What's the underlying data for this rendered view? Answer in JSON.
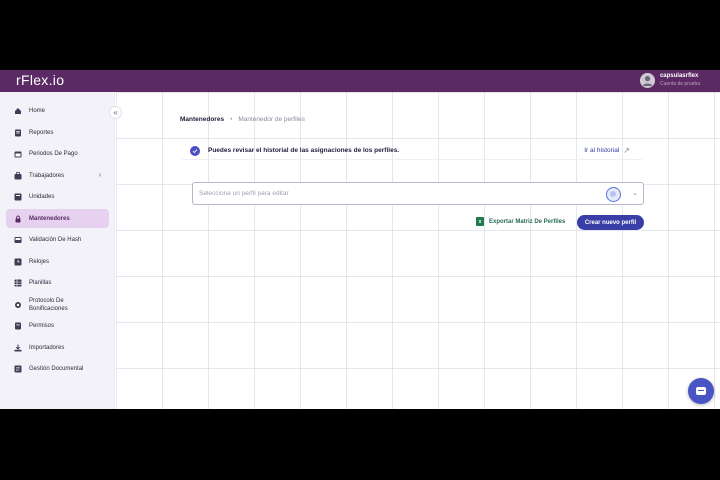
{
  "app": {
    "logo": "rFlex.io",
    "user_name": "capsulasrflex",
    "user_subtitle": "Cuenta de prueba"
  },
  "sidebar": {
    "items": [
      {
        "label": "Home",
        "icon": "home-icon",
        "active": false
      },
      {
        "label": "Reportes",
        "icon": "report-icon",
        "active": false
      },
      {
        "label": "Periodos De Pago",
        "icon": "calendar-icon",
        "active": false
      },
      {
        "label": "Trabajadores",
        "icon": "workers-icon",
        "active": false,
        "has_children": true
      },
      {
        "label": "Unidades",
        "icon": "units-icon",
        "active": false
      },
      {
        "label": "Mantenedores",
        "icon": "lock-icon",
        "active": true
      },
      {
        "label": "Validación De Hash",
        "icon": "hash-icon",
        "active": false
      },
      {
        "label": "Relojes",
        "icon": "clock-icon",
        "active": false
      },
      {
        "label": "Planillas",
        "icon": "spreadsheet-icon",
        "active": false
      },
      {
        "label": "Protocolo De Bonificaciones",
        "icon": "bonus-icon",
        "active": false
      },
      {
        "label": "Permisos",
        "icon": "permissions-icon",
        "active": false
      },
      {
        "label": "Importadores",
        "icon": "import-icon",
        "active": false
      },
      {
        "label": "Gestión Documental",
        "icon": "documents-icon",
        "active": false
      }
    ],
    "trabajadores_label_line1": "Protocolo De",
    "trabajadores_label_line2": "Bonificaciones"
  },
  "breadcrumb": {
    "section": "Mantenedores",
    "separator": "•",
    "page": "Mantenedor de perfiles"
  },
  "info_banner": {
    "text": "Puedes revisar el historial de las asignaciones de los perfiles.",
    "link": "Ir al historial"
  },
  "profile_select": {
    "placeholder": "Selecciona un perfil para editar"
  },
  "actions": {
    "export_label": "Exportar Matriz De Perfiles",
    "create_label": "Crear nuevo perfil"
  },
  "colors": {
    "topbar": "#5b2a64",
    "active_nav": "#e6d2f0",
    "primary_button": "#3a3fa8",
    "excel_green": "#1f7a4d"
  }
}
